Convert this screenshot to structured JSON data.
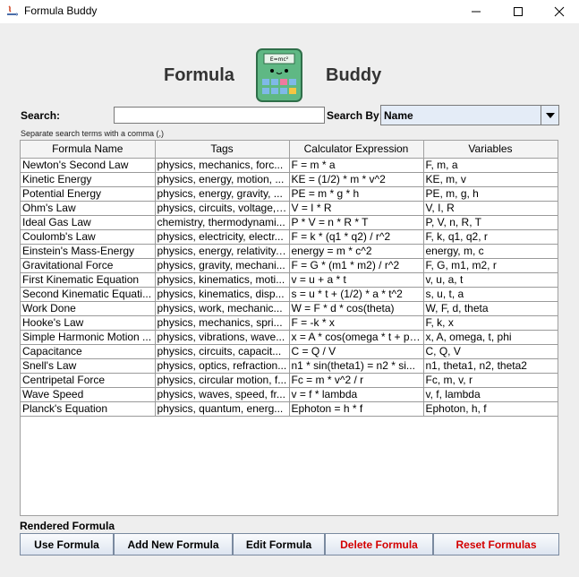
{
  "window": {
    "title": "Formula Buddy"
  },
  "header": {
    "left_word": "Formula",
    "right_word": "Buddy",
    "logo_screen_text": "E=mc²"
  },
  "search": {
    "label": "Search:",
    "value": "",
    "placeholder": "",
    "search_by_label": "Search By:",
    "search_by_value": "Name",
    "hint": "Separate search terms with a comma (,)"
  },
  "table": {
    "columns": [
      "Formula Name",
      "Tags",
      "Calculator Expression",
      "Variables"
    ],
    "rows": [
      [
        "Newton's Second Law",
        "physics, mechanics, forc...",
        "F = m * a",
        "F, m, a"
      ],
      [
        "Kinetic Energy",
        "physics, energy, motion, ...",
        "KE = (1/2) * m * v^2",
        "KE, m, v"
      ],
      [
        "Potential Energy",
        "physics, energy, gravity, ...",
        "PE = m * g * h",
        "PE, m, g, h"
      ],
      [
        "Ohm's Law",
        "physics, circuits, voltage, ...",
        "V = I * R",
        "V, I, R"
      ],
      [
        "Ideal Gas Law",
        "chemistry, thermodynami...",
        "P * V = n * R * T",
        "P, V, n, R, T"
      ],
      [
        "Coulomb's Law",
        "physics, electricity, electr...",
        "F = k * (q1 * q2) / r^2",
        "F, k, q1, q2, r"
      ],
      [
        "Einstein's Mass-Energy",
        "physics, energy, relativity,...",
        "energy = m * c^2",
        "energy, m, c"
      ],
      [
        "Gravitational Force",
        "physics, gravity, mechani...",
        "F = G * (m1 * m2) / r^2",
        "F, G, m1, m2, r"
      ],
      [
        "First Kinematic Equation",
        "physics, kinematics, moti...",
        "v = u + a * t",
        "v, u, a, t"
      ],
      [
        "Second Kinematic Equati...",
        "physics, kinematics, disp...",
        "s = u * t + (1/2) * a * t^2",
        "s, u, t, a"
      ],
      [
        "Work Done",
        "physics, work, mechanic...",
        "W = F * d * cos(theta)",
        "W, F, d, theta"
      ],
      [
        "Hooke's Law",
        "physics, mechanics, spri...",
        "F = -k * x",
        "F, k, x"
      ],
      [
        "Simple Harmonic Motion ...",
        "physics, vibrations, wave...",
        "x = A * cos(omega * t + phi)",
        "x, A, omega, t, phi"
      ],
      [
        "Capacitance",
        "physics, circuits, capacit...",
        "C = Q / V",
        "C, Q, V"
      ],
      [
        "Snell's Law",
        "physics, optics, refraction...",
        "n1 * sin(theta1) = n2 * si...",
        "n1, theta1, n2, theta2"
      ],
      [
        "Centripetal Force",
        "physics, circular motion, f...",
        "Fc = m * v^2 / r",
        "Fc, m, v, r"
      ],
      [
        "Wave Speed",
        "physics, waves, speed, fr...",
        "v = f * lambda",
        "v, f, lambda"
      ],
      [
        "Planck's Equation",
        "physics, quantum, energ...",
        "Ephoton = h * f",
        "Ephoton, h, f"
      ]
    ]
  },
  "rendered_formula_label": "Rendered Formula",
  "buttons": {
    "use": "Use Formula",
    "add": "Add New Formula",
    "edit": "Edit Formula",
    "delete": "Delete Formula",
    "reset": "Reset Formulas"
  },
  "colors": {
    "danger_text": "#d40000",
    "logo_green": "#5fb884"
  }
}
